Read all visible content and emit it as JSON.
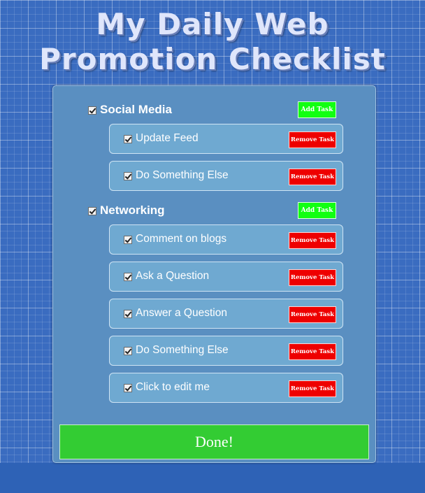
{
  "title_line1": "My Daily Web",
  "title_line2": "Promotion Checklist",
  "categories": [
    {
      "label": "Social Media",
      "checked": true,
      "add_label": "Add Task",
      "tasks": [
        {
          "label": "Update Feed",
          "checked": true,
          "remove_label": "Remove Task"
        },
        {
          "label": "Do Something Else",
          "checked": true,
          "remove_label": "Remove Task"
        }
      ]
    },
    {
      "label": "Networking",
      "checked": true,
      "add_label": "Add Task",
      "tasks": [
        {
          "label": "Comment on blogs",
          "checked": true,
          "remove_label": "Remove Task"
        },
        {
          "label": "Ask a Question",
          "checked": true,
          "remove_label": "Remove Task"
        },
        {
          "label": "Answer a Question",
          "checked": true,
          "remove_label": "Remove Task"
        },
        {
          "label": "Do Something Else",
          "checked": true,
          "remove_label": "Remove Task"
        },
        {
          "label": "Click to edit me",
          "checked": true,
          "remove_label": "Remove Task"
        }
      ]
    }
  ],
  "done_label": "Done!",
  "colors": {
    "background": "#3a6cc0",
    "panel": "#5a8fc1",
    "task_box": "#6fa9d1",
    "add_button": "#11ff11",
    "remove_button": "#ee0000",
    "done_button": "#33cc33"
  }
}
